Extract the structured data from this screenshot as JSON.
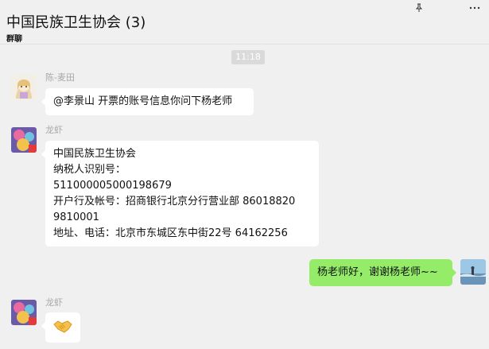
{
  "window": {
    "title": "中国民族卫生协会 (3)",
    "subtitle": "群聊",
    "pin_icon": "pin-icon",
    "more_icon": "more-icon"
  },
  "chat": {
    "timestamp": "11:18",
    "messages": [
      {
        "sender": "陈-麦田",
        "avatar_icon": "anime-girl-avatar",
        "lines": [
          "@李景山 开票的账号信息你问下杨老师"
        ]
      },
      {
        "sender": "龙虾",
        "avatar_icon": "colorful-avatar",
        "lines": [
          "中国民族卫生协会",
          "纳税人识别号：",
          "511000005000198679",
          "开户行及帐号：招商银行北京分行营业部  86018820",
          "9810001",
          "地址、电话：北京市东城区东中街22号  64162256"
        ]
      },
      {
        "sender": "",
        "avatar_icon": "landscape-avatar",
        "self": true,
        "lines": [
          "杨老师好，谢谢杨老师~~"
        ]
      },
      {
        "sender": "龙虾",
        "avatar_icon": "colorful-avatar",
        "emoji": "handshake-icon"
      }
    ]
  }
}
